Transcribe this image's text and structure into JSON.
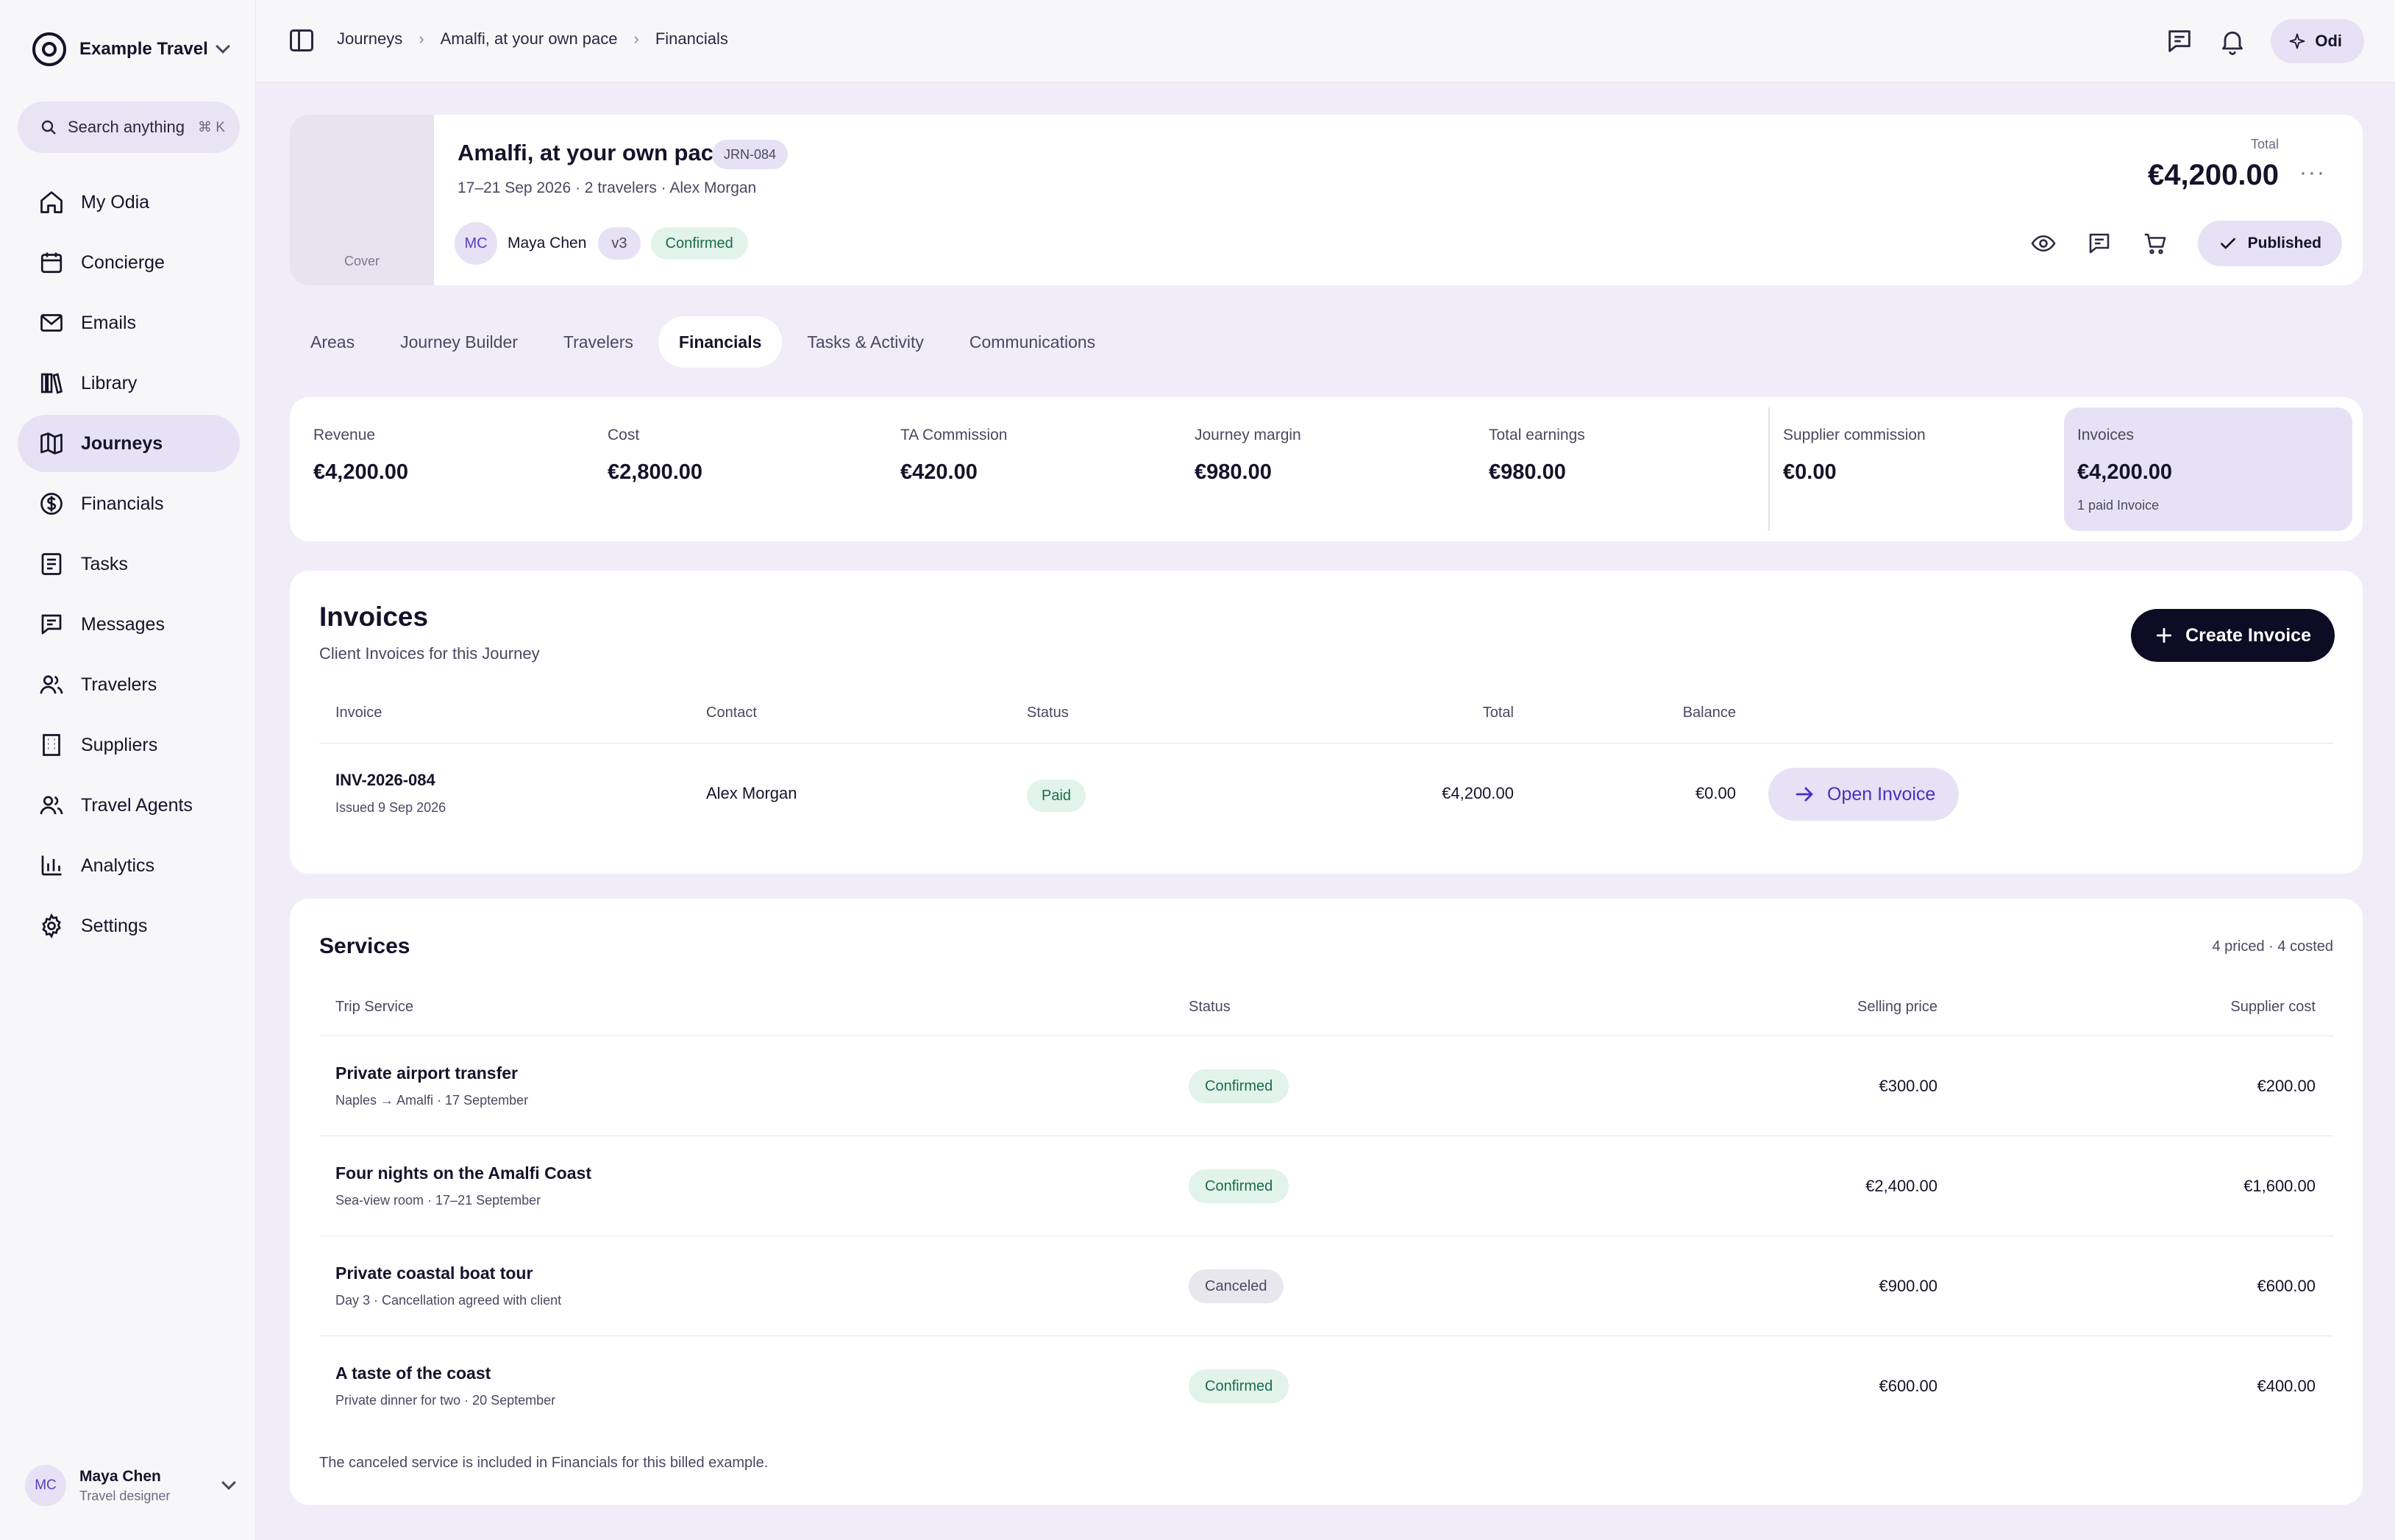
{
  "sidebar": {
    "brand": "Example Travel",
    "search": {
      "label": "Search anything",
      "shortcut": "⌘ K"
    },
    "items": [
      {
        "label": "My Odia",
        "icon": "home-icon"
      },
      {
        "label": "Concierge",
        "icon": "calendar-icon"
      },
      {
        "label": "Emails",
        "icon": "mail-icon"
      },
      {
        "label": "Library",
        "icon": "library-icon"
      },
      {
        "label": "Journeys",
        "icon": "map-icon",
        "active": true
      },
      {
        "label": "Financials",
        "icon": "dollar-icon"
      },
      {
        "label": "Tasks",
        "icon": "tasks-icon"
      },
      {
        "label": "Messages",
        "icon": "message-icon"
      },
      {
        "label": "Travelers",
        "icon": "users-icon"
      },
      {
        "label": "Suppliers",
        "icon": "building-icon"
      },
      {
        "label": "Travel Agents",
        "icon": "users-icon"
      },
      {
        "label": "Analytics",
        "icon": "chart-icon"
      },
      {
        "label": "Settings",
        "icon": "gear-icon"
      }
    ],
    "user": {
      "initials": "MC",
      "name": "Maya Chen",
      "role": "Travel designer"
    }
  },
  "topbar": {
    "breadcrumbs": [
      "Journeys",
      "Amalfi, at your own pace",
      "Financials"
    ],
    "assistant_label": "Odi"
  },
  "journey": {
    "cover_label": "Cover",
    "title": "Amalfi, at your own pace",
    "code": "JRN-084",
    "subtitle": "17–21 Sep 2026 · 2 travelers · Alex Morgan",
    "owner_initials": "MC",
    "owner_name": "Maya Chen",
    "version": "v3",
    "status": "Confirmed",
    "total_label": "Total",
    "total_value": "€4,200.00",
    "more": "···",
    "publish_label": "Published"
  },
  "tabs": [
    "Areas",
    "Journey Builder",
    "Travelers",
    "Financials",
    "Tasks & Activity",
    "Communications"
  ],
  "active_tab": "Financials",
  "stats": {
    "revenue": {
      "label": "Revenue",
      "value": "€4,200.00"
    },
    "cost": {
      "label": "Cost",
      "value": "€2,800.00"
    },
    "commission": {
      "label": "TA Commission",
      "value": "€420.00"
    },
    "margin": {
      "label": "Journey margin",
      "value": "€980.00"
    },
    "earnings": {
      "label": "Total earnings",
      "value": "€980.00"
    },
    "supplier_commission": {
      "label": "Supplier commission",
      "value": "€0.00"
    },
    "invoices": {
      "label": "Invoices",
      "value": "€4,200.00",
      "note": "1 paid Invoice"
    }
  },
  "invoices": {
    "title": "Invoices",
    "subtitle": "Client Invoices for this Journey",
    "create_label": "Create Invoice",
    "columns": {
      "invoice": "Invoice",
      "contact": "Contact",
      "status": "Status",
      "total": "Total",
      "balance": "Balance"
    },
    "rows": [
      {
        "number": "INV-2026-084",
        "issued": "Issued 9 Sep 2026",
        "contact": "Alex Morgan",
        "status": "Paid",
        "total": "€4,200.00",
        "balance": "€0.00",
        "action": "Open Invoice"
      }
    ]
  },
  "services": {
    "title": "Services",
    "count": "4 priced · 4 costed",
    "columns": {
      "service": "Trip Service",
      "status": "Status",
      "selling": "Selling price",
      "cost": "Supplier cost"
    },
    "rows": [
      {
        "name": "Private airport transfer",
        "desc": "Naples → Amalfi · 17 September",
        "status": "Confirmed",
        "selling": "€300.00",
        "cost": "€200.00"
      },
      {
        "name": "Four nights on the Amalfi Coast",
        "desc": "Sea-view room · 17–21 September",
        "status": "Confirmed",
        "selling": "€2,400.00",
        "cost": "€1,600.00"
      },
      {
        "name": "Private coastal boat tour",
        "desc": "Day 3 · Cancellation agreed with client",
        "status": "Canceled",
        "selling": "€900.00",
        "cost": "€600.00"
      },
      {
        "name": "A taste of the coast",
        "desc": "Private dinner for two · 20 September",
        "status": "Confirmed",
        "selling": "€600.00",
        "cost": "€400.00"
      }
    ],
    "footnote": "The canceled service is included in Financials for this billed example."
  },
  "colors": {
    "accent": "#4a2fc0",
    "accent_soft": "#e6e1f4",
    "success_bg": "#e1f3ea",
    "success_text": "#1e6b49",
    "primary_button": "#0e0c24",
    "page_bg": "#f0edf8"
  }
}
